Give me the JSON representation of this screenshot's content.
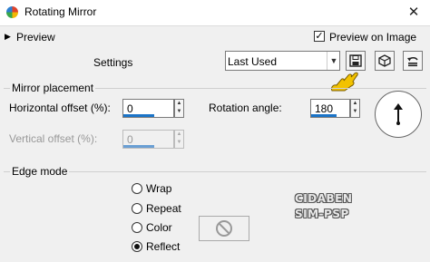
{
  "window": {
    "title": "Rotating Mirror",
    "close_glyph": "✕"
  },
  "preview": {
    "label": "Preview",
    "preview_on_image_label": "Preview on Image",
    "preview_on_image_checked": true
  },
  "settings": {
    "label": "Settings",
    "selected": "Last Used"
  },
  "mirror_placement": {
    "title": "Mirror placement",
    "horizontal_offset": {
      "label": "Horizontal offset (%):",
      "value": "0"
    },
    "vertical_offset": {
      "label": "Vertical offset (%):",
      "value": "0",
      "disabled": true
    },
    "rotation_angle": {
      "label": "Rotation angle:",
      "value": "180"
    }
  },
  "edge_mode": {
    "title": "Edge mode",
    "options": [
      {
        "label": "Wrap",
        "checked": false
      },
      {
        "label": "Repeat",
        "checked": false
      },
      {
        "label": "Color",
        "checked": false
      },
      {
        "label": "Reflect",
        "checked": true
      }
    ]
  },
  "watermark": {
    "line1": "CIDABEN",
    "line2": "SIM-PSP"
  },
  "icons": {
    "app": "rotating-mirror-icon",
    "save": "save-icon",
    "presets": "presets-cube-icon",
    "reset": "reset-icon",
    "pointer": "hand-pointer-icon",
    "no_color": "no-color-icon"
  },
  "colors": {
    "accent": "#1b74c8",
    "pointer_yellow": "#f2c200"
  }
}
